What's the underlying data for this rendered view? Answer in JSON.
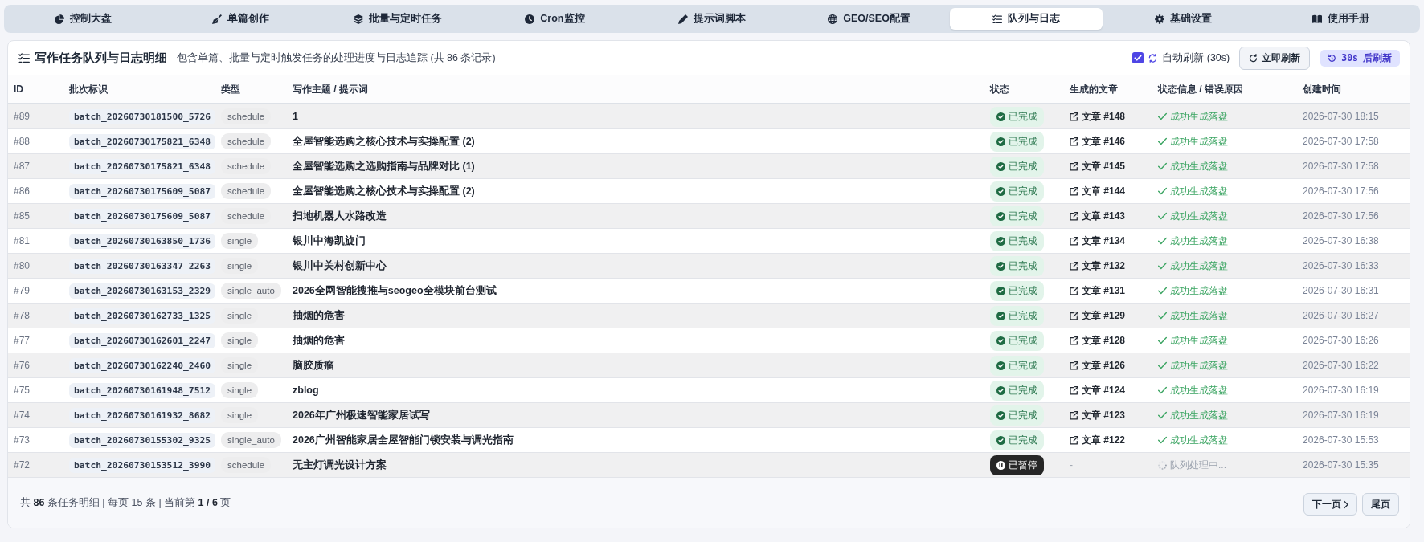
{
  "nav": {
    "tabs": [
      {
        "label": "控制大盘",
        "selected": false
      },
      {
        "label": "单篇创作",
        "selected": false
      },
      {
        "label": "批量与定时任务",
        "selected": false
      },
      {
        "label": "Cron监控",
        "selected": false
      },
      {
        "label": "提示词脚本",
        "selected": false
      },
      {
        "label": "GEO/SEO配置",
        "selected": false
      },
      {
        "label": "队列与日志",
        "selected": true
      },
      {
        "label": "基础设置",
        "selected": false
      },
      {
        "label": "使用手册",
        "selected": false
      }
    ]
  },
  "header": {
    "title": "写作任务队列与日志明细",
    "subtitle": "包含单篇、批量与定时触发任务的处理进度与日志追踪 (共 86 条记录)",
    "auto_refresh": {
      "label": "自动刷新 (30s)",
      "checked": true
    },
    "refresh_button": "立即刷新",
    "countdown": {
      "value": "30s",
      "suffix": "后刷新"
    }
  },
  "table": {
    "columns": [
      "ID",
      "批次标识",
      "类型",
      "写作主题 / 提示词",
      "状态",
      "生成的文章",
      "状态信息 / 错误原因",
      "创建时间"
    ],
    "rows": [
      {
        "id": "#89",
        "batch": "batch_20260730181500_5726",
        "type": "schedule",
        "topic": "1",
        "status": {
          "kind": "done",
          "label": "已完成"
        },
        "article": {
          "kind": "link",
          "label": "文章 #148"
        },
        "message": {
          "kind": "success",
          "text": "成功生成落盘"
        },
        "time": "2026-07-30 18:15"
      },
      {
        "id": "#88",
        "batch": "batch_20260730175821_6348",
        "type": "schedule",
        "topic": "全屋智能选购之核心技术与实操配置 (2)",
        "status": {
          "kind": "done",
          "label": "已完成"
        },
        "article": {
          "kind": "link",
          "label": "文章 #146"
        },
        "message": {
          "kind": "success",
          "text": "成功生成落盘"
        },
        "time": "2026-07-30 17:58"
      },
      {
        "id": "#87",
        "batch": "batch_20260730175821_6348",
        "type": "schedule",
        "topic": "全屋智能选购之选购指南与品牌对比 (1)",
        "status": {
          "kind": "done",
          "label": "已完成"
        },
        "article": {
          "kind": "link",
          "label": "文章 #145"
        },
        "message": {
          "kind": "success",
          "text": "成功生成落盘"
        },
        "time": "2026-07-30 17:58"
      },
      {
        "id": "#86",
        "batch": "batch_20260730175609_5087",
        "type": "schedule",
        "topic": "全屋智能选购之核心技术与实操配置 (2)",
        "status": {
          "kind": "done",
          "label": "已完成"
        },
        "article": {
          "kind": "link",
          "label": "文章 #144"
        },
        "message": {
          "kind": "success",
          "text": "成功生成落盘"
        },
        "time": "2026-07-30 17:56"
      },
      {
        "id": "#85",
        "batch": "batch_20260730175609_5087",
        "type": "schedule",
        "topic": "扫地机器人水路改造",
        "status": {
          "kind": "done",
          "label": "已完成"
        },
        "article": {
          "kind": "link",
          "label": "文章 #143"
        },
        "message": {
          "kind": "success",
          "text": "成功生成落盘"
        },
        "time": "2026-07-30 17:56"
      },
      {
        "id": "#81",
        "batch": "batch_20260730163850_1736",
        "type": "single",
        "topic": "银川中海凯旋门",
        "status": {
          "kind": "done",
          "label": "已完成"
        },
        "article": {
          "kind": "link",
          "label": "文章 #134"
        },
        "message": {
          "kind": "success",
          "text": "成功生成落盘"
        },
        "time": "2026-07-30 16:38"
      },
      {
        "id": "#80",
        "batch": "batch_20260730163347_2263",
        "type": "single",
        "topic": "银川中关村创新中心",
        "status": {
          "kind": "done",
          "label": "已完成"
        },
        "article": {
          "kind": "link",
          "label": "文章 #132"
        },
        "message": {
          "kind": "success",
          "text": "成功生成落盘"
        },
        "time": "2026-07-30 16:33"
      },
      {
        "id": "#79",
        "batch": "batch_20260730163153_2329",
        "type": "single_auto",
        "topic": "2026全网智能搜推与seogeo全模块前台测试",
        "status": {
          "kind": "done",
          "label": "已完成"
        },
        "article": {
          "kind": "link",
          "label": "文章 #131"
        },
        "message": {
          "kind": "success",
          "text": "成功生成落盘"
        },
        "time": "2026-07-30 16:31"
      },
      {
        "id": "#78",
        "batch": "batch_20260730162733_1325",
        "type": "single",
        "topic": "抽烟的危害",
        "status": {
          "kind": "done",
          "label": "已完成"
        },
        "article": {
          "kind": "link",
          "label": "文章 #129"
        },
        "message": {
          "kind": "success",
          "text": "成功生成落盘"
        },
        "time": "2026-07-30 16:27"
      },
      {
        "id": "#77",
        "batch": "batch_20260730162601_2247",
        "type": "single",
        "topic": "抽烟的危害",
        "status": {
          "kind": "done",
          "label": "已完成"
        },
        "article": {
          "kind": "link",
          "label": "文章 #128"
        },
        "message": {
          "kind": "success",
          "text": "成功生成落盘"
        },
        "time": "2026-07-30 16:26"
      },
      {
        "id": "#76",
        "batch": "batch_20260730162240_2460",
        "type": "single",
        "topic": "脑胶质瘤",
        "status": {
          "kind": "done",
          "label": "已完成"
        },
        "article": {
          "kind": "link",
          "label": "文章 #126"
        },
        "message": {
          "kind": "success",
          "text": "成功生成落盘"
        },
        "time": "2026-07-30 16:22"
      },
      {
        "id": "#75",
        "batch": "batch_20260730161948_7512",
        "type": "single",
        "topic": "zblog",
        "status": {
          "kind": "done",
          "label": "已完成"
        },
        "article": {
          "kind": "link",
          "label": "文章 #124"
        },
        "message": {
          "kind": "success",
          "text": "成功生成落盘"
        },
        "time": "2026-07-30 16:19"
      },
      {
        "id": "#74",
        "batch": "batch_20260730161932_8682",
        "type": "single",
        "topic": "2026年广州极速智能家居试写",
        "status": {
          "kind": "done",
          "label": "已完成"
        },
        "article": {
          "kind": "link",
          "label": "文章 #123"
        },
        "message": {
          "kind": "success",
          "text": "成功生成落盘"
        },
        "time": "2026-07-30 16:19"
      },
      {
        "id": "#73",
        "batch": "batch_20260730155302_9325",
        "type": "single_auto",
        "topic": "2026广州智能家居全屋智能门锁安装与调光指南",
        "status": {
          "kind": "done",
          "label": "已完成"
        },
        "article": {
          "kind": "link",
          "label": "文章 #122"
        },
        "message": {
          "kind": "success",
          "text": "成功生成落盘"
        },
        "time": "2026-07-30 15:53"
      },
      {
        "id": "#72",
        "batch": "batch_20260730153512_3990",
        "type": "schedule",
        "topic": "无主灯调光设计方案",
        "status": {
          "kind": "paused",
          "label": "已暂停"
        },
        "article": {
          "kind": "none",
          "label": "-"
        },
        "message": {
          "kind": "pending",
          "text": "队列处理中..."
        },
        "time": "2026-07-30 15:35"
      }
    ]
  },
  "footer": {
    "summary": "共 **86** 条任务明细 | 每页 15 条 | 当前第 **1 / 6** 页",
    "buttons": [
      {
        "kind": "next",
        "label": "下一页"
      },
      {
        "kind": "last",
        "label": "尾页"
      }
    ]
  }
}
